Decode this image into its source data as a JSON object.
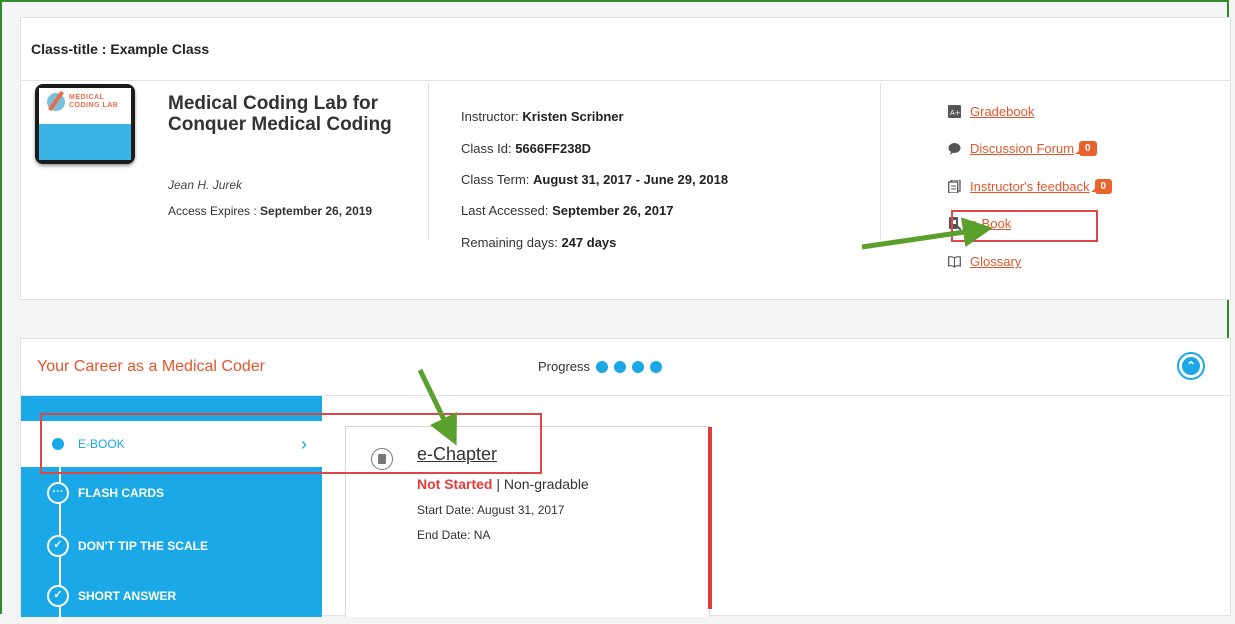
{
  "class_title": "Class-title : Example Class",
  "course": {
    "title": "Medical Coding Lab for Conquer Medical Coding",
    "author": "Jean H. Jurek",
    "access_label": "Access Expires : ",
    "access_value": "September 26, 2019",
    "logo_line1": "MEDICAL",
    "logo_line2": "CODING LAB"
  },
  "info": {
    "instructor_label": "Instructor: ",
    "instructor_value": "Kristen Scribner",
    "classid_label": "Class Id: ",
    "classid_value": "5666FF238D",
    "term_label": "Class Term: ",
    "term_value": "August 31, 2017 - June 29, 2018",
    "last_label": "Last Accessed: ",
    "last_value": "September 26, 2017",
    "remaining_label": "Remaining days: ",
    "remaining_value": "247 days"
  },
  "links": {
    "gradebook": "Gradebook",
    "forum": "Discussion Forum",
    "forum_count": "0",
    "feedback": "Instructor's feedback",
    "feedback_count": "0",
    "ebook": "e-Book",
    "glossary": "Glossary"
  },
  "module": {
    "title": "Your Career as a Medical Coder",
    "progress_label": "Progress",
    "items": [
      {
        "label": "E-BOOK"
      },
      {
        "label": "FLASH CARDS"
      },
      {
        "label": "DON'T TIP THE SCALE"
      },
      {
        "label": "SHORT ANSWER"
      }
    ]
  },
  "chapter": {
    "title": "e-Chapter",
    "status": "Not Started",
    "separator": " | ",
    "gradable": "Non-gradable",
    "start_date": "Start Date: August 31, 2017",
    "end_date": "End Date: NA"
  },
  "colors": {
    "accent": "#1aa8e6",
    "link": "#e3562b",
    "highlight": "#e04646",
    "arrow": "#5aa02c"
  }
}
